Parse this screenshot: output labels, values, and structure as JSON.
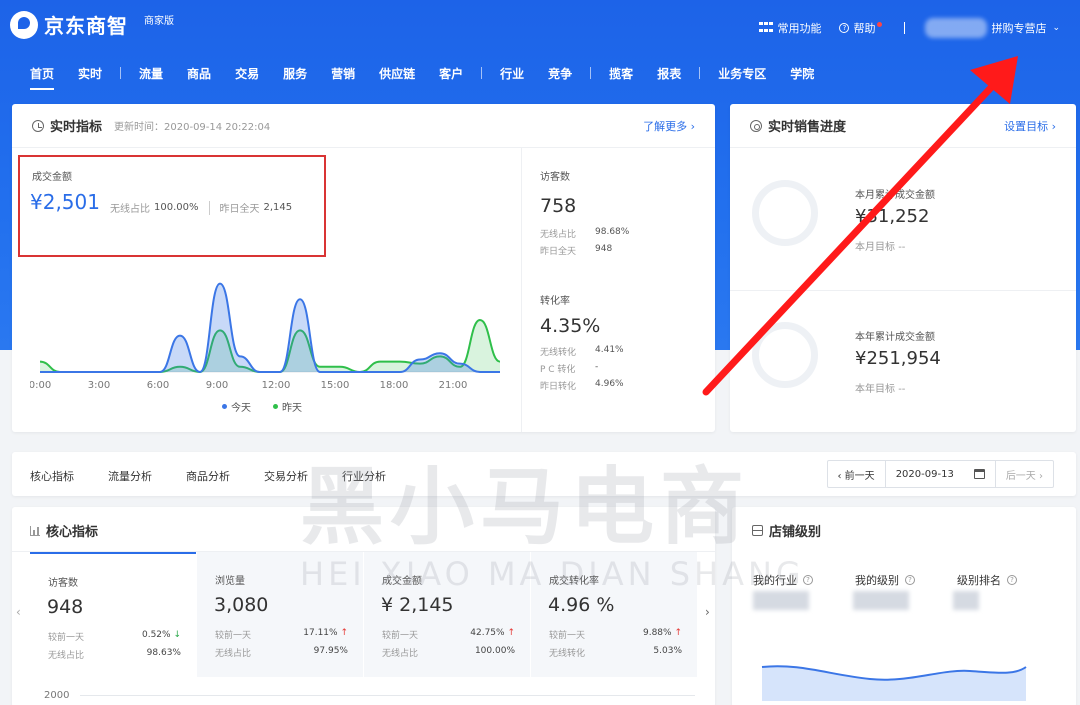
{
  "brand": {
    "name": "京东商智",
    "edition": "商家版"
  },
  "topbar": {
    "common_functions": "常用功能",
    "help": "帮助",
    "store_name": "拼购专营店"
  },
  "nav": {
    "items": [
      "首页",
      "实时",
      "流量",
      "商品",
      "交易",
      "服务",
      "营销",
      "供应链",
      "客户",
      "行业",
      "竞争",
      "揽客",
      "报表",
      "业务专区",
      "学院"
    ]
  },
  "realtime": {
    "title": "实时指标",
    "update_time": "更新时间：2020-09-14 20:22:04",
    "more_link": "了解更多 ›",
    "gmv": {
      "label": "成交金额",
      "value": "¥2,501",
      "wireless_label": "无线占比",
      "wireless_value": "100.00%",
      "yesterday_label": "昨日全天",
      "yesterday_value": "2,145"
    },
    "visitors": {
      "label": "访客数",
      "value": "758",
      "row1_label": "无线占比",
      "row1_value": "98.68%",
      "row2_label": "昨日全天",
      "row2_value": "948"
    },
    "conversion": {
      "label": "转化率",
      "value": "4.35%",
      "row1_label": "无线转化",
      "row1_value": "4.41%",
      "row2_label": "P C 转化",
      "row2_value": "-",
      "row3_label": "昨日转化",
      "row3_value": "4.96%"
    },
    "x_ticks": [
      "0:00",
      "3:00",
      "6:00",
      "9:00",
      "12:00",
      "15:00",
      "18:00",
      "21:00"
    ],
    "legend_today": "今天",
    "legend_yesterday": "昨天",
    "color_today": "#3b76e6",
    "color_yesterday": "#2fbf4a"
  },
  "chart_data": {
    "type": "area",
    "x": [
      0,
      1,
      2,
      3,
      4,
      5,
      6,
      7,
      8,
      9,
      10,
      11,
      12,
      13,
      14,
      15,
      16,
      17,
      18,
      19,
      20,
      21,
      22,
      23
    ],
    "series": [
      {
        "name": "今天",
        "values": [
          0,
          0,
          0,
          0,
          0,
          0,
          0,
          35,
          0,
          85,
          15,
          0,
          0,
          70,
          0,
          0,
          0,
          0,
          0,
          12,
          18,
          8,
          0,
          0
        ]
      },
      {
        "name": "昨天",
        "values": [
          10,
          0,
          0,
          0,
          0,
          0,
          0,
          5,
          0,
          40,
          5,
          0,
          0,
          40,
          5,
          5,
          0,
          10,
          10,
          8,
          15,
          5,
          50,
          10
        ]
      }
    ],
    "ylim": [
      0,
      100
    ]
  },
  "sales_progress": {
    "title": "实时销售进度",
    "set_target": "设置目标 ›",
    "month": {
      "label": "本月累计成交金额",
      "value": "¥31,252",
      "target_label": "本月目标",
      "target_value": "--"
    },
    "year": {
      "label": "本年累计成交金额",
      "value": "¥251,954",
      "target_label": "本年目标",
      "target_value": "--"
    }
  },
  "analysis_tabs": [
    "核心指标",
    "流量分析",
    "商品分析",
    "交易分析",
    "行业分析"
  ],
  "date_picker": {
    "prev": "‹ 前一天",
    "date": "2020-09-13",
    "next": "后一天 ›"
  },
  "core_metrics": {
    "title": "核心指标",
    "items": [
      {
        "label": "访客数",
        "value": "948",
        "r1_label": "较前一天",
        "r1_value": "0.52%",
        "r1_dir": "↓",
        "r2_label": "无线占比",
        "r2_value": "98.63%"
      },
      {
        "label": "浏览量",
        "value": "3,080",
        "r1_label": "较前一天",
        "r1_value": "17.11%",
        "r1_dir": "↑",
        "r2_label": "无线占比",
        "r2_value": "97.95%"
      },
      {
        "label": "成交金额",
        "value": "¥ 2,145",
        "r1_label": "较前一天",
        "r1_value": "42.75%",
        "r1_dir": "↑",
        "r2_label": "无线占比",
        "r2_value": "100.00%"
      },
      {
        "label": "成交转化率",
        "value": "4.96 %",
        "r1_label": "较前一天",
        "r1_value": "9.88%",
        "r1_dir": "↑",
        "r2_label": "无线转化",
        "r2_value": "5.03%"
      }
    ],
    "y_tick": "2000"
  },
  "store_level": {
    "title": "店铺级别",
    "cols": [
      "我的行业",
      "我的级别",
      "级别排名"
    ]
  },
  "watermark": {
    "main": "黑小马电商",
    "sub": "HEI XIAO MA DIAN SHANG"
  }
}
